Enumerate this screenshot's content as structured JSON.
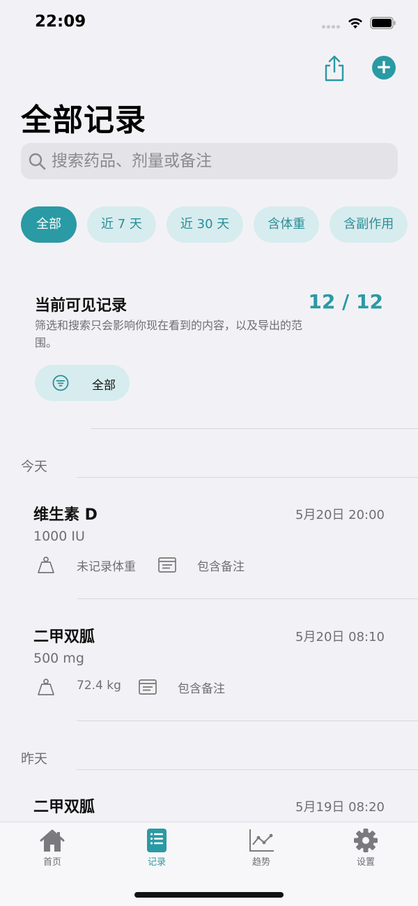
{
  "status": {
    "time": "22:09"
  },
  "header": {
    "title": "全部记录"
  },
  "search": {
    "placeholder": "搜索药品、剂量或备注"
  },
  "filters": [
    {
      "label": "全部",
      "active": true
    },
    {
      "label": "近 7 天",
      "active": false
    },
    {
      "label": "近 30 天",
      "active": false
    },
    {
      "label": "含体重",
      "active": false
    },
    {
      "label": "含副作用",
      "active": false
    }
  ],
  "summary": {
    "title": "当前可见记录",
    "count": "12 / 12",
    "description": "筛选和搜索只会影响你现在看到的内容，以及导出的范围。",
    "filter_label": "全部"
  },
  "sections": [
    {
      "header": "今天",
      "records": [
        {
          "name": "维生素 D",
          "time": "5月20日 20:00",
          "dose": "1000 IU",
          "weight": "未记录体重",
          "note": "包含备注"
        },
        {
          "name": "二甲双胍",
          "time": "5月20日 08:10",
          "dose": "500 mg",
          "weight": "72.4 kg",
          "note": "包含备注"
        }
      ]
    },
    {
      "header": "昨天",
      "records": [
        {
          "name": "二甲双胍",
          "time": "5月19日 08:20"
        }
      ]
    }
  ],
  "tabs": [
    {
      "label": "首页",
      "icon": "house-icon",
      "active": false
    },
    {
      "label": "记录",
      "icon": "list-icon",
      "active": true
    },
    {
      "label": "趋势",
      "icon": "chart-icon",
      "active": false
    },
    {
      "label": "设置",
      "icon": "gear-icon",
      "active": false
    }
  ],
  "colors": {
    "accent": "#2a9aa4",
    "chip_bg": "#d7ecee",
    "background": "#f2f2f6"
  }
}
